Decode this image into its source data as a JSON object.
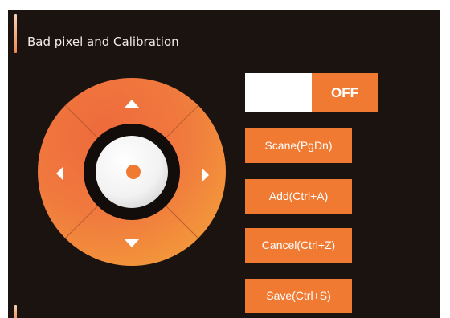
{
  "section": {
    "title": "Bad pixel and Calibration"
  },
  "toggle": {
    "state_label": "OFF"
  },
  "actions": {
    "scan_label": "Scane(PgDn)",
    "add_label": "Add(Ctrl+A)",
    "cancel_label": "Cancel(Ctrl+Z)",
    "save_label": "Save(Ctrl+S)"
  },
  "colors": {
    "accent": "#f07a32",
    "panel_background": "#1b1310",
    "dpad_inner": "#f0f0f0",
    "dpad_ring": "#120d0b"
  },
  "icons": {
    "up": "arrow-up-icon",
    "down": "arrow-down-icon",
    "left": "arrow-left-icon",
    "right": "arrow-right-icon",
    "center": "center-dot-icon"
  }
}
